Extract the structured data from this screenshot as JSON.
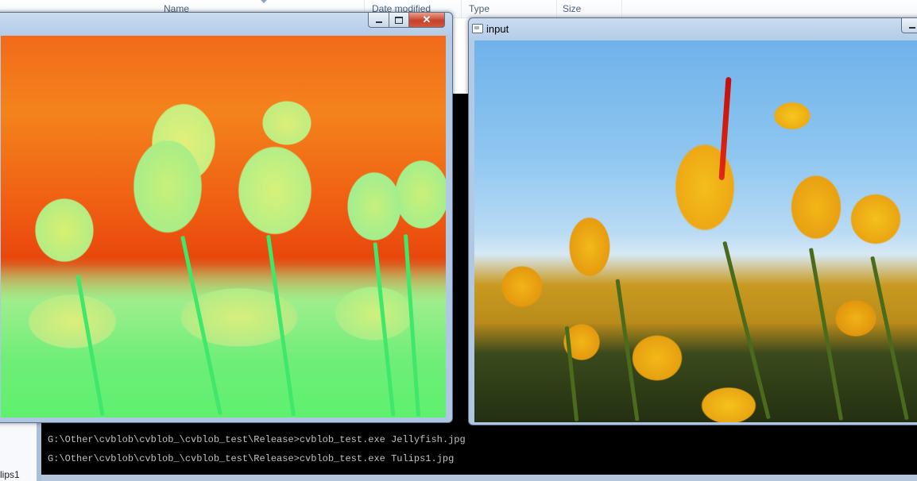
{
  "explorer": {
    "columns": [
      "Name",
      "Date modified",
      "Type",
      "Size"
    ],
    "status_fragment": "lips1"
  },
  "console": {
    "lines": [
      "G:\\Other\\cvblob\\cvblob_\\cvblob_test\\Release>cvblob_test.exe Jellyfish.jpg",
      "G:\\Other\\cvblob\\cvblob_\\cvblob_test\\Release>cvblob_test.exe Tulips1.jpg"
    ]
  },
  "windows": {
    "output": {
      "title": "",
      "min_label": "minimize",
      "max_label": "maximize",
      "close_label": "✕"
    },
    "input": {
      "title": "input"
    }
  },
  "colors": {
    "title_bar": "#b3cbe6",
    "close_button": "#c7432b",
    "console_bg": "#000000",
    "console_text": "#c0c0c0"
  }
}
